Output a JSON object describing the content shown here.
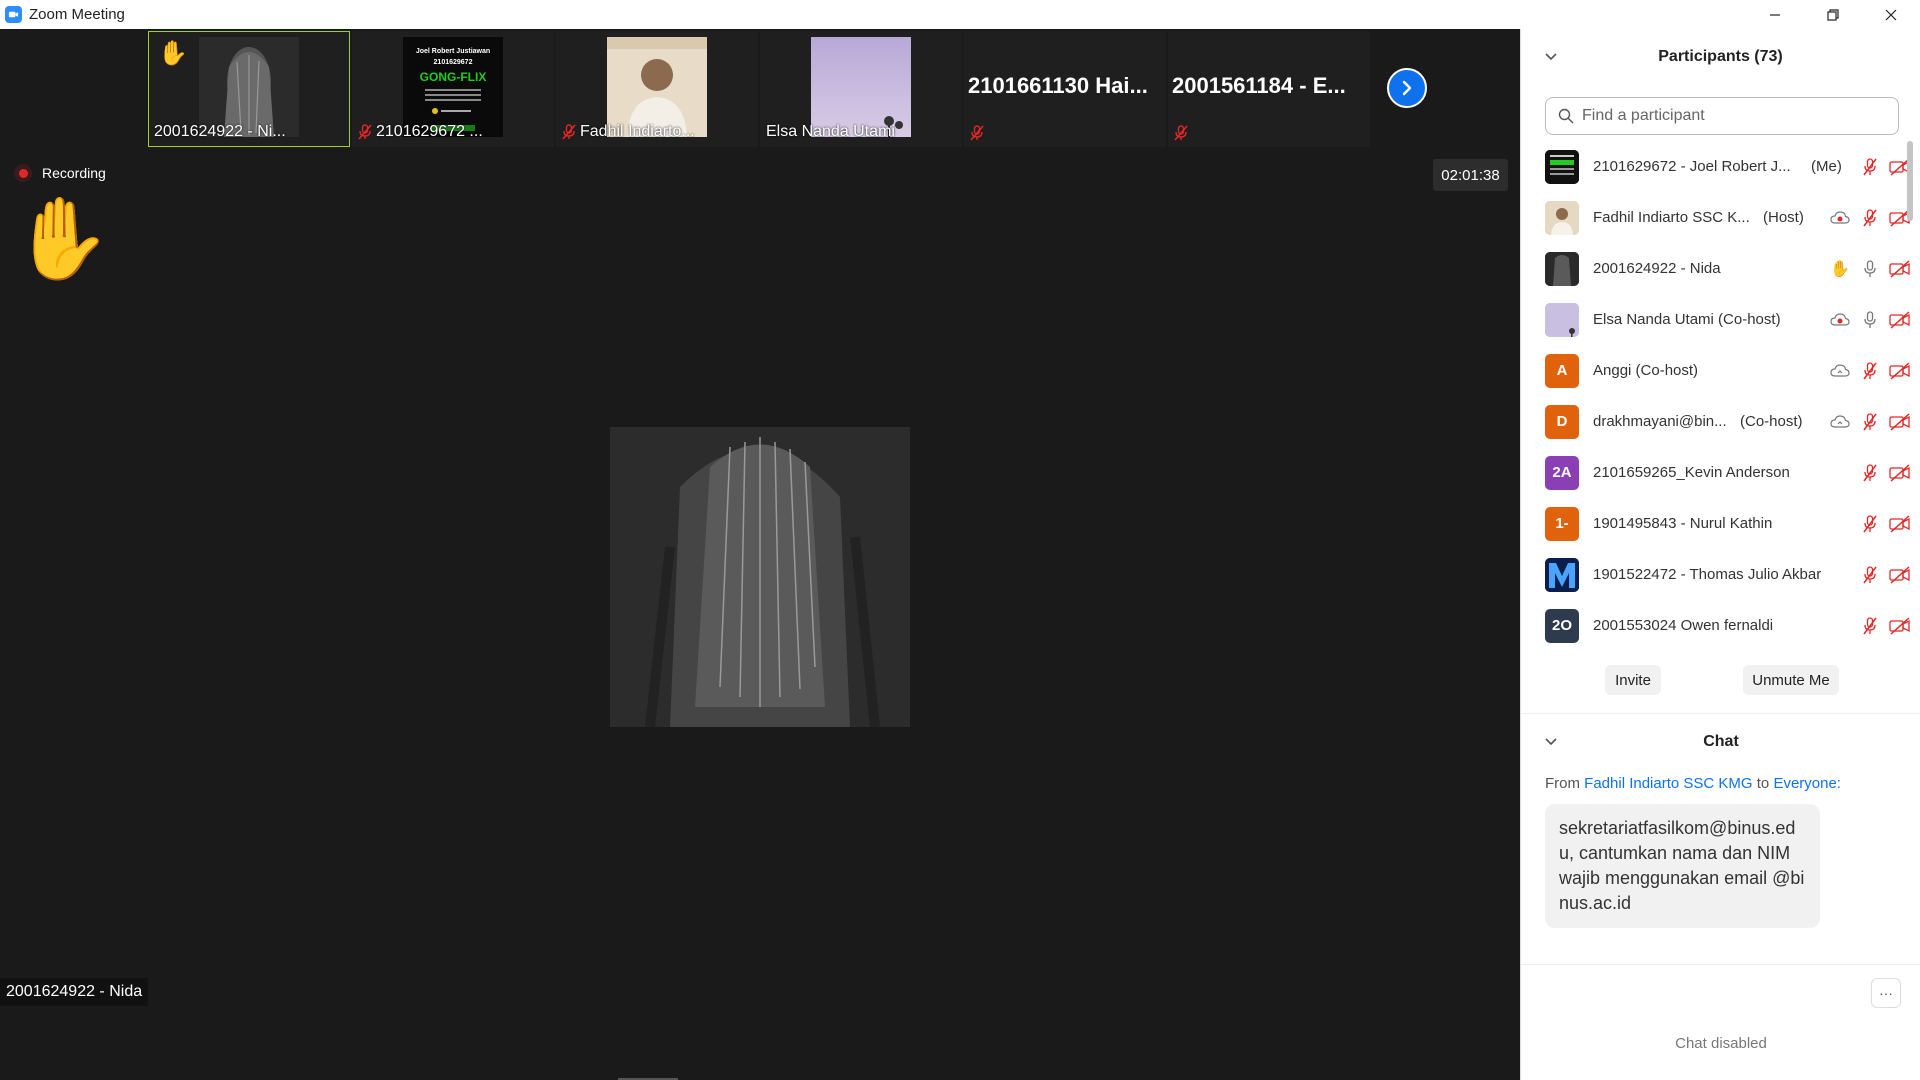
{
  "window": {
    "title": "Zoom Meeting"
  },
  "strip": {
    "tiles": [
      {
        "name": "2001624922 - Ni..."
      },
      {
        "name": "2101629672 ..."
      },
      {
        "name": "Fadhil Indiarto..."
      },
      {
        "name": "Elsa Nanda Utami"
      },
      {
        "name": "2101661130  Hai..."
      },
      {
        "name": "2001561184 - E..."
      }
    ],
    "gong_thumb": {
      "line1": "Joel Robert Justiawan",
      "line2": "2101629672",
      "line3": "GONG-FLIX"
    }
  },
  "recording": {
    "label": "Recording"
  },
  "timer": {
    "value": "02:01:38"
  },
  "speaker": {
    "name": "2001624922 - Nida"
  },
  "participants": {
    "title": "Participants (73)",
    "search_placeholder": "Find a participant",
    "list": [
      {
        "name": "2101629672 - Joel Robert J...",
        "tag": "(Me)",
        "initials": "",
        "color": "#1a1a1a"
      },
      {
        "name": "Fadhil Indiarto SSC K...",
        "tag": "(Host)",
        "initials": "",
        "color": "#d9cbb5"
      },
      {
        "name": "2001624922 - Nida",
        "tag": "",
        "initials": "",
        "color": "#2a2a2a"
      },
      {
        "name": "Elsa Nanda Utami (Co-host)",
        "tag": "",
        "initials": "",
        "color": "#c9bfe0"
      },
      {
        "name": "Anggi (Co-host)",
        "tag": "",
        "initials": "A",
        "color": "#e0620d"
      },
      {
        "name": "drakhmayani@bin...",
        "tag": "(Co-host)",
        "initials": "D",
        "color": "#e0620d"
      },
      {
        "name": "2101659265_Kevin Anderson",
        "tag": "",
        "initials": "2A",
        "color": "#8a3fb5"
      },
      {
        "name": "1901495843 - Nurul Kathin",
        "tag": "",
        "initials": "1-",
        "color": "#e0620d"
      },
      {
        "name": "1901522472 - Thomas Julio Akbar",
        "tag": "",
        "initials": "",
        "color": "#0a1f4d"
      },
      {
        "name": "2001553024 Owen fernaldi",
        "tag": "",
        "initials": "2O",
        "color": "#2e3a4d"
      }
    ],
    "invite_label": "Invite",
    "unmute_label": "Unmute Me"
  },
  "chat": {
    "title": "Chat",
    "from_prefix": "From",
    "from_name": "Fadhil Indiarto SSC KMG",
    "to_word": "to",
    "to_name": "Everyone:",
    "message": "sekretariatfasilkom@binus.edu, cantumkan nama dan NIM wajib menggunakan email @binus.ac.id",
    "more_label": "···",
    "disabled_label": "Chat disabled"
  },
  "colors": {
    "accent": "#0e72ed",
    "mute_red": "#e02828",
    "active_border": "#9bd41f"
  }
}
